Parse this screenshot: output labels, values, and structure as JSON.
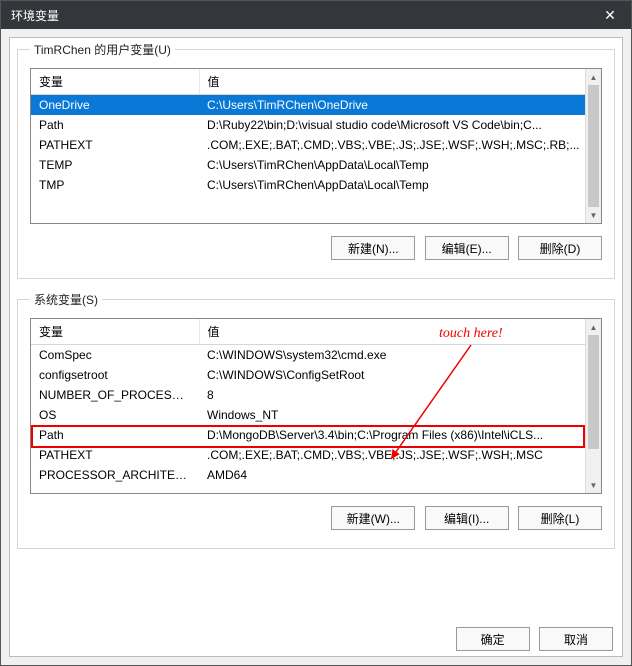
{
  "window": {
    "title": "环境变量"
  },
  "icons": {
    "close": "✕"
  },
  "userSection": {
    "legend": "TimRChen 的用户变量(U)",
    "headers": {
      "variable": "变量",
      "value": "值"
    },
    "rows": [
      {
        "variable": "OneDrive",
        "value": "C:\\Users\\TimRChen\\OneDrive",
        "selected": true
      },
      {
        "variable": "Path",
        "value": "D:\\Ruby22\\bin;D:\\visual studio code\\Microsoft VS Code\\bin;C..."
      },
      {
        "variable": "PATHEXT",
        "value": ".COM;.EXE;.BAT;.CMD;.VBS;.VBE;.JS;.JSE;.WSF;.WSH;.MSC;.RB;..."
      },
      {
        "variable": "TEMP",
        "value": "C:\\Users\\TimRChen\\AppData\\Local\\Temp"
      },
      {
        "variable": "TMP",
        "value": "C:\\Users\\TimRChen\\AppData\\Local\\Temp"
      }
    ],
    "buttons": {
      "new": "新建(N)...",
      "edit": "编辑(E)...",
      "del": "删除(D)"
    }
  },
  "sysSection": {
    "legend": "系统变量(S)",
    "headers": {
      "variable": "变量",
      "value": "值"
    },
    "rows": [
      {
        "variable": "ComSpec",
        "value": "C:\\WINDOWS\\system32\\cmd.exe"
      },
      {
        "variable": "configsetroot",
        "value": "C:\\WINDOWS\\ConfigSetRoot"
      },
      {
        "variable": "NUMBER_OF_PROCESSORS",
        "value": "8"
      },
      {
        "variable": "OS",
        "value": "Windows_NT"
      },
      {
        "variable": "Path",
        "value": "D:\\MongoDB\\Server\\3.4\\bin;C:\\Program Files (x86)\\Intel\\iCLS...",
        "highlight": true
      },
      {
        "variable": "PATHEXT",
        "value": ".COM;.EXE;.BAT;.CMD;.VBS;.VBE;.JS;.JSE;.WSF;.WSH;.MSC"
      },
      {
        "variable": "PROCESSOR_ARCHITECT...",
        "value": "AMD64"
      }
    ],
    "buttons": {
      "new": "新建(W)...",
      "edit": "编辑(I)...",
      "del": "删除(L)"
    }
  },
  "dialogButtons": {
    "ok": "确定",
    "cancel": "取消"
  },
  "annotation": {
    "text": "touch here!"
  }
}
